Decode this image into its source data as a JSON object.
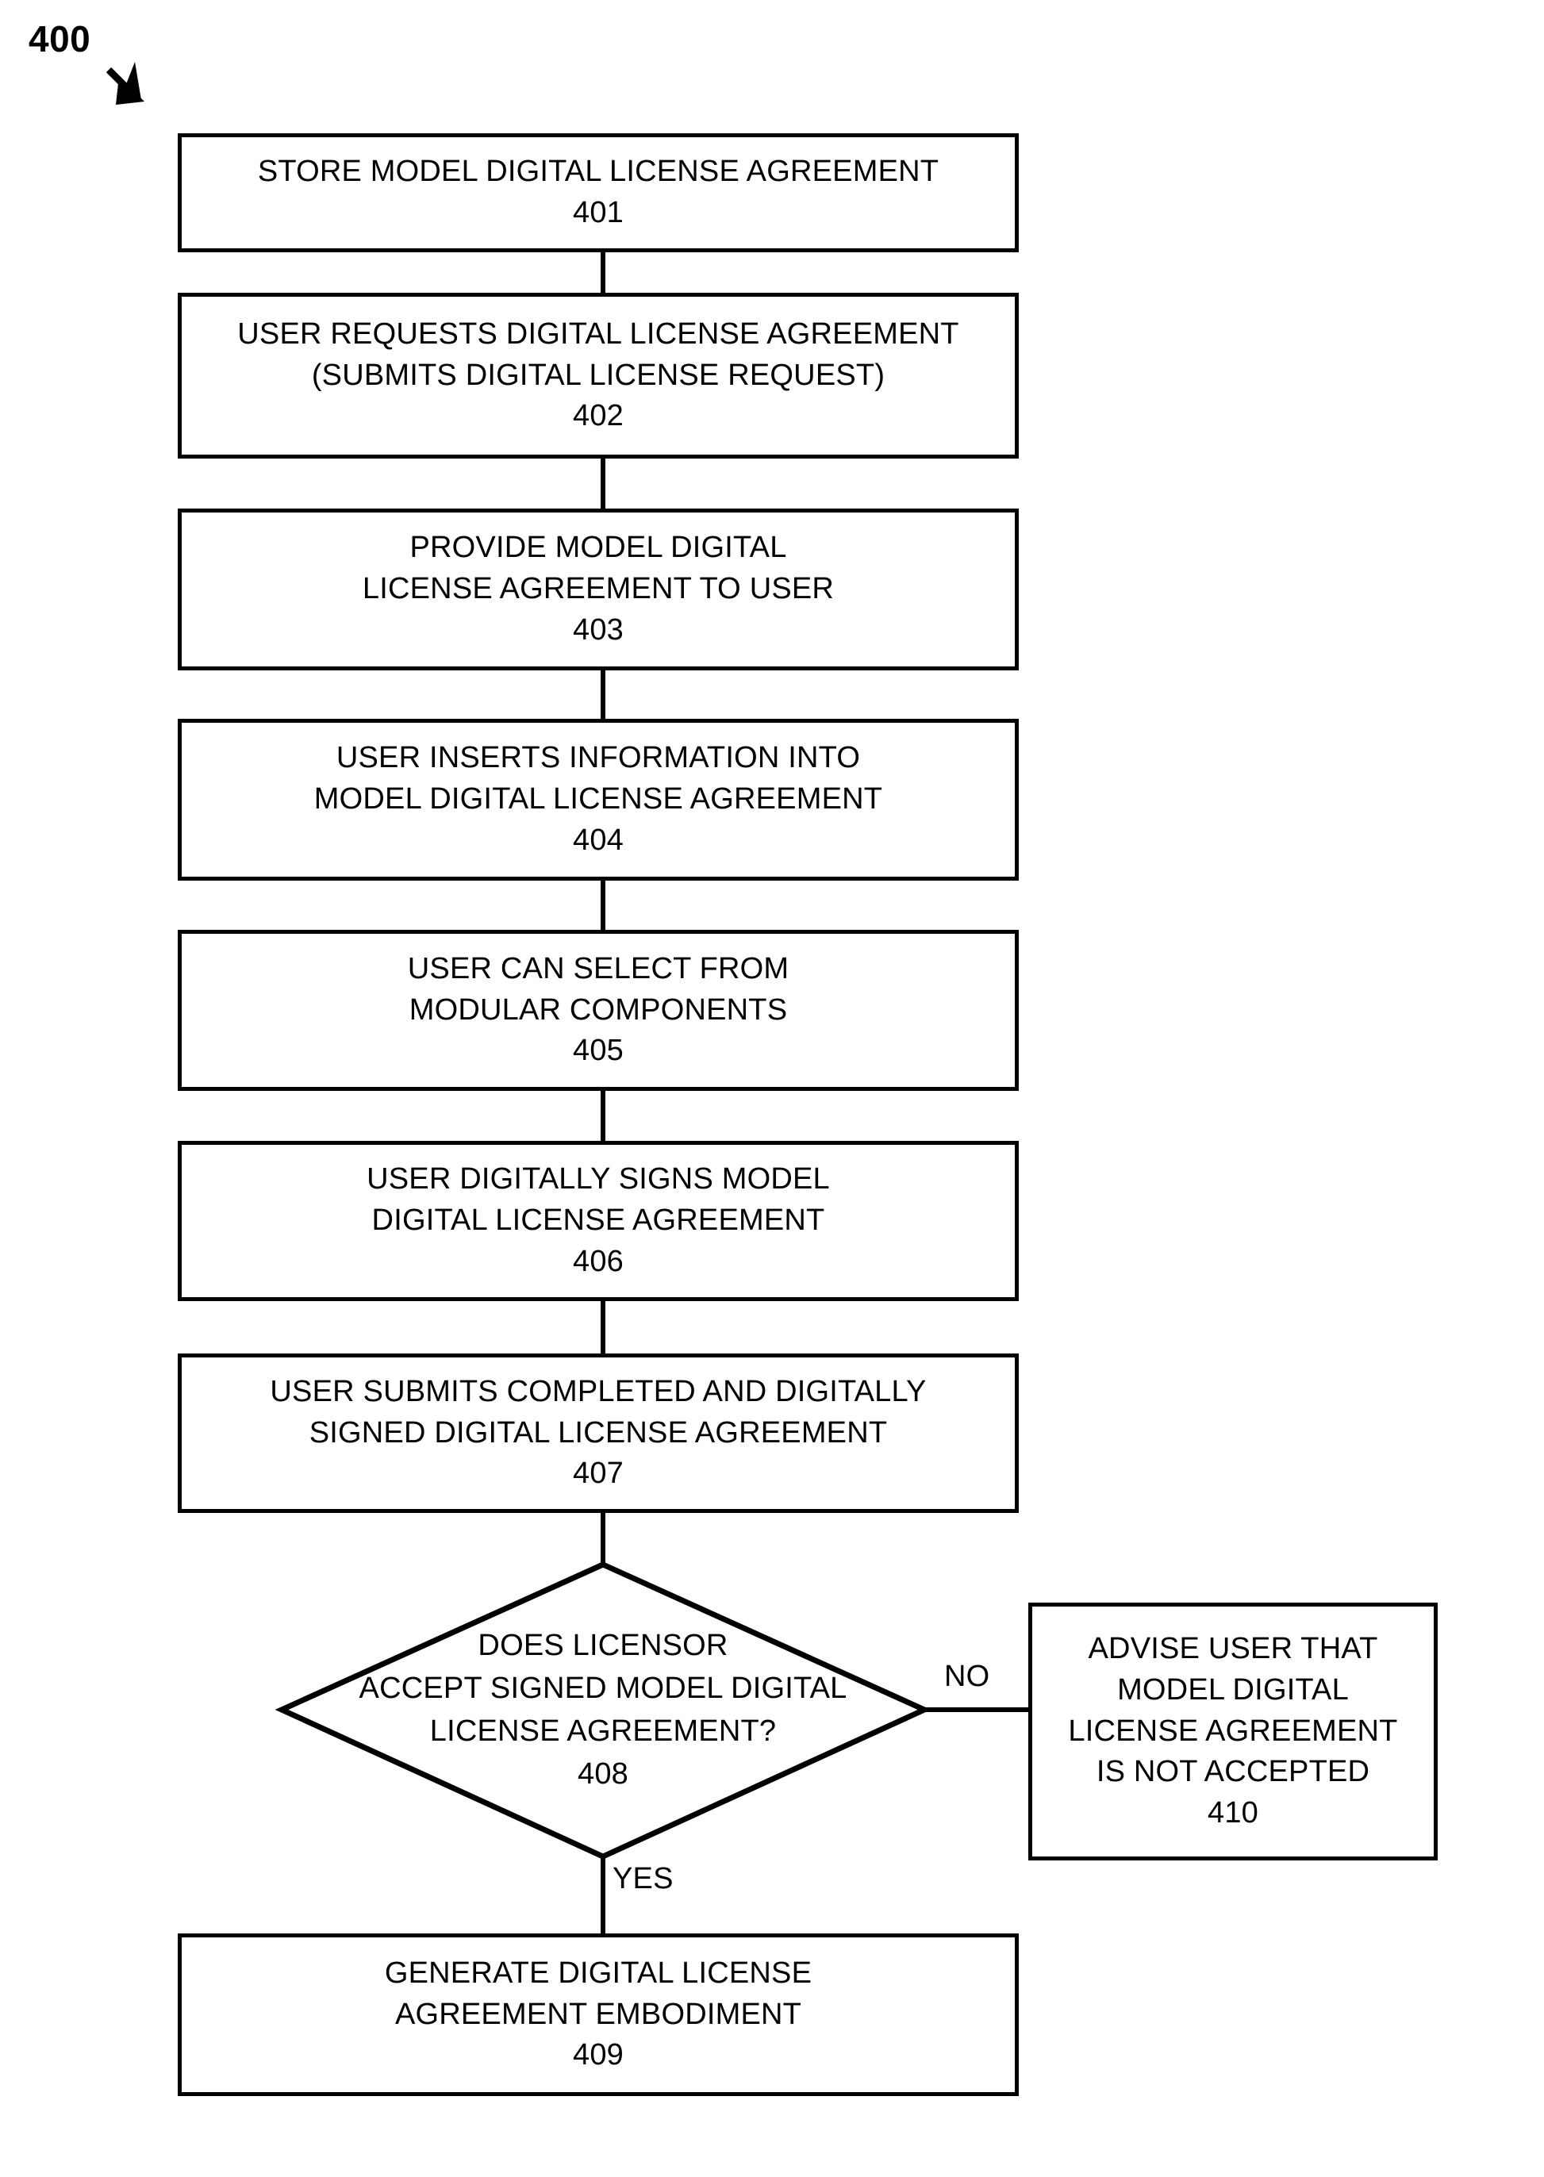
{
  "figure": {
    "number": "400",
    "pointer_icon": "arrow-down-right-icon"
  },
  "nodes": [
    {
      "id": "401",
      "name": "store-model-digital-license-agreement",
      "shape": "process",
      "lines": [
        "STORE MODEL DIGITAL LICENSE AGREEMENT"
      ],
      "number": "401"
    },
    {
      "id": "402",
      "name": "user-requests-digital-license-agreement",
      "shape": "process",
      "lines": [
        "USER REQUESTS DIGITAL LICENSE AGREEMENT",
        "(SUBMITS DIGITAL LICENSE REQUEST)"
      ],
      "number": "402"
    },
    {
      "id": "403",
      "name": "provide-model-digital-license-agreement-to-user",
      "shape": "process",
      "lines": [
        "PROVIDE MODEL DIGITAL",
        "LICENSE AGREEMENT TO USER"
      ],
      "number": "403"
    },
    {
      "id": "404",
      "name": "user-inserts-information-into-model-agreement",
      "shape": "process",
      "lines": [
        "USER INSERTS INFORMATION INTO",
        "MODEL DIGITAL LICENSE AGREEMENT"
      ],
      "number": "404"
    },
    {
      "id": "405",
      "name": "user-can-select-from-modular-components",
      "shape": "process",
      "lines": [
        "USER CAN SELECT FROM",
        "MODULAR COMPONENTS"
      ],
      "number": "405"
    },
    {
      "id": "406",
      "name": "user-digitally-signs-model-agreement",
      "shape": "process",
      "lines": [
        "USER DIGITALLY SIGNS MODEL",
        "DIGITAL LICENSE AGREEMENT"
      ],
      "number": "406"
    },
    {
      "id": "407",
      "name": "user-submits-completed-and-signed-agreement",
      "shape": "process",
      "lines": [
        "USER SUBMITS COMPLETED AND DIGITALLY",
        "SIGNED DIGITAL LICENSE AGREEMENT"
      ],
      "number": "407"
    },
    {
      "id": "408",
      "name": "does-licensor-accept-signed-model-agreement",
      "shape": "decision",
      "lines": [
        "DOES LICENSOR",
        "ACCEPT SIGNED MODEL DIGITAL",
        "LICENSE AGREEMENT?"
      ],
      "number": "408"
    },
    {
      "id": "409",
      "name": "generate-digital-license-agreement-embodiment",
      "shape": "process",
      "lines": [
        "GENERATE DIGITAL LICENSE",
        "AGREEMENT EMBODIMENT"
      ],
      "number": "409"
    },
    {
      "id": "410",
      "name": "advise-user-agreement-not-accepted",
      "shape": "process",
      "lines": [
        "ADVISE USER THAT",
        "MODEL DIGITAL",
        "LICENSE AGREEMENT",
        "IS NOT ACCEPTED"
      ],
      "number": "410"
    }
  ],
  "edge_labels": {
    "no": "NO",
    "yes": "YES"
  },
  "colors": {
    "stroke": "#000000",
    "fill": "#ffffff"
  }
}
